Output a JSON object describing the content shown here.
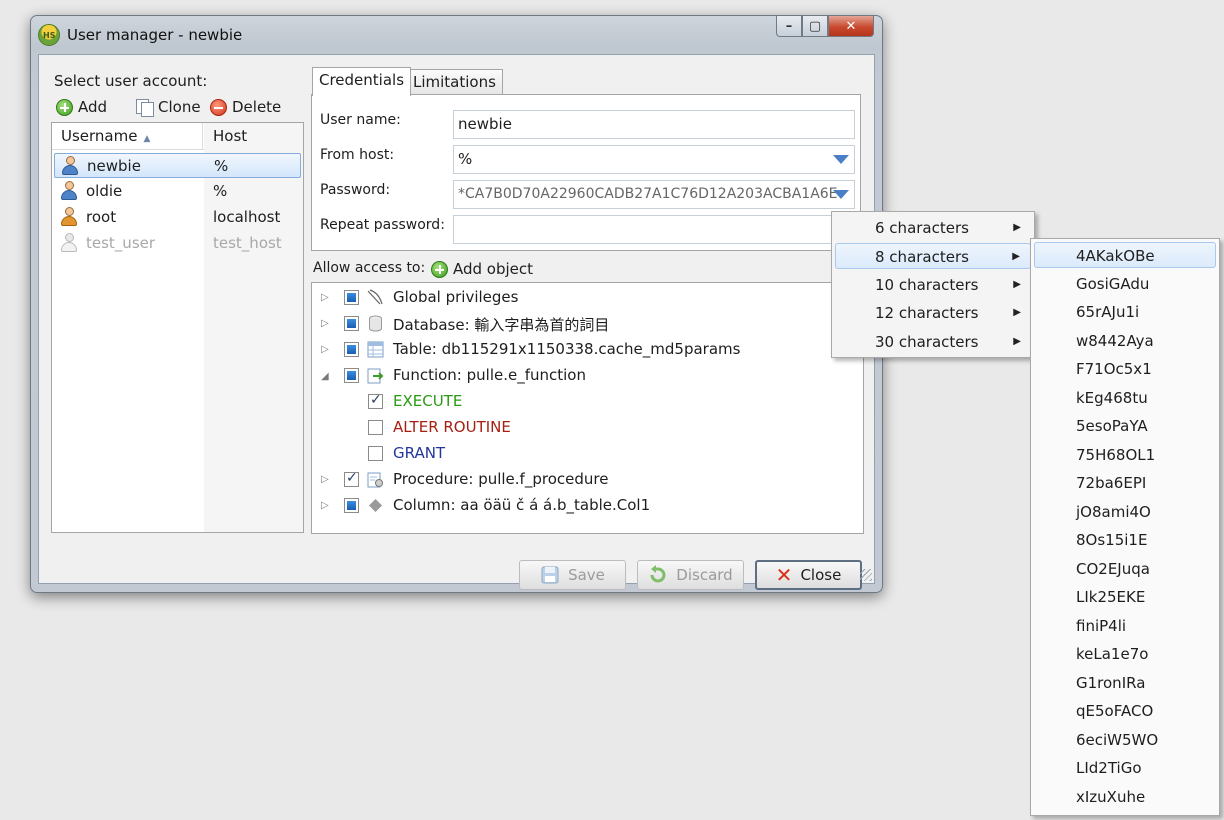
{
  "window": {
    "title": "User manager - newbie",
    "app_icon_text": "HS"
  },
  "left": {
    "select_label": "Select user account:",
    "toolbar": {
      "add": "Add",
      "clone": "Clone",
      "delete": "Delete"
    },
    "columns": {
      "username": "Username",
      "host": "Host"
    },
    "users": [
      {
        "name": "newbie",
        "host": "%",
        "selected": true,
        "icon": "user-icon"
      },
      {
        "name": "oldie",
        "host": "%",
        "icon": "user-icon"
      },
      {
        "name": "root",
        "host": "localhost",
        "icon": "admin-user-icon"
      },
      {
        "name": "test_user",
        "host": "test_host",
        "disabled": true,
        "icon": "disabled-user-icon"
      }
    ]
  },
  "tabs": {
    "credentials": "Credentials",
    "limitations": "Limitations"
  },
  "credentials": {
    "username_label": "User name:",
    "username_value": "newbie",
    "fromhost_label": "From host:",
    "fromhost_value": "%",
    "password_label": "Password:",
    "password_value": "*CA7B0D70A22960CADB27A1C76D12A203ACBA1A6E",
    "repeat_label": "Repeat password:",
    "repeat_value": ""
  },
  "access": {
    "label": "Allow access to:",
    "add_object": "Add object",
    "nodes": {
      "global": "Global privileges",
      "database": "Database: 輸入字串為首的詞目",
      "table": "Table: db115291x1150338.cache_md5params",
      "function": "Function: pulle.e_function",
      "execute": "EXECUTE",
      "alter_routine": "ALTER ROUTINE",
      "grant": "GRANT",
      "procedure": "Procedure: pulle.f_procedure",
      "column": "Column: aa öäü č á á.b_table.Col1"
    }
  },
  "buttons": {
    "save": "Save",
    "discard": "Discard",
    "close": "Close"
  },
  "password_menu": {
    "lengths": [
      "6 characters",
      "8 characters",
      "10 characters",
      "12 characters",
      "30 characters"
    ],
    "highlighted": "8 characters",
    "generated": [
      "4AKakOBe",
      "GosiGAdu",
      "65rAJu1i",
      "w8442Aya",
      "F71Oc5x1",
      "kEg468tu",
      "5esoPaYA",
      "75H68OL1",
      "72ba6EPI",
      "jO8ami4O",
      "8Os15i1E",
      "CO2EJuqa",
      "LIk25EKE",
      "finiP4li",
      "keLa1e7o",
      "G1ronIRa",
      "qE5oFACO",
      "6eciW5WO",
      "LId2TiGo",
      "xIzuXuhe"
    ]
  },
  "colors": {
    "execute": "#2a9a14",
    "alter_routine": "#a51f12",
    "grant": "#24369c",
    "selection": "#d3e6fb",
    "close_button_titlebar": "#c8492f"
  }
}
